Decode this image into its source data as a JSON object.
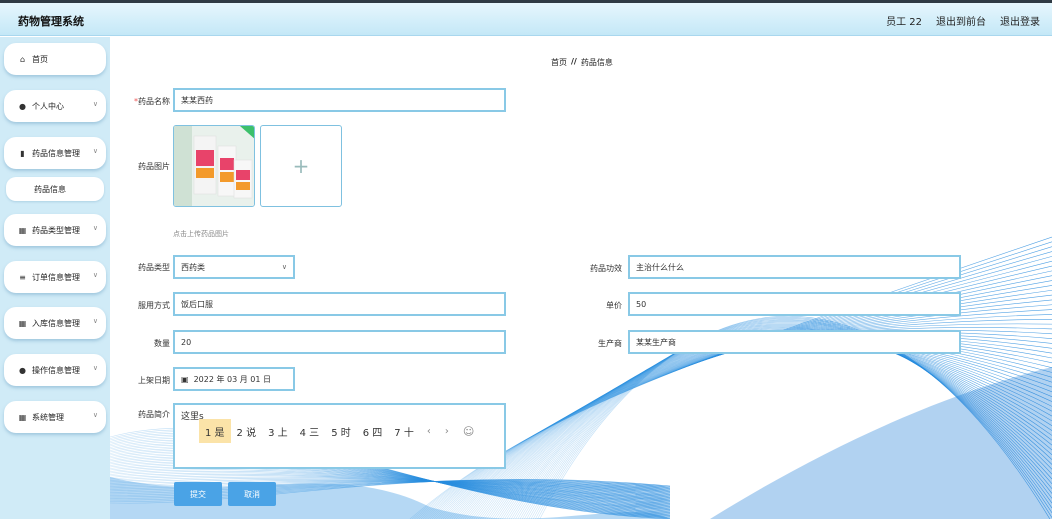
{
  "header": {
    "app_title": "药物管理系统",
    "user": "员工 22",
    "to_front": "退出到前台",
    "logout": "退出登录"
  },
  "sidebar": {
    "items": [
      {
        "label": "首页",
        "icon": "home-icon"
      },
      {
        "label": "个人中心",
        "icon": "user-icon"
      },
      {
        "label": "药品信息管理",
        "icon": "bars-icon"
      },
      {
        "label": "药品信息",
        "icon": ""
      },
      {
        "label": "药品类型管理",
        "icon": "grid-icon"
      },
      {
        "label": "订单信息管理",
        "icon": "list-icon"
      },
      {
        "label": "入库信息管理",
        "icon": "grid3-icon"
      },
      {
        "label": "操作信息管理",
        "icon": "user-icon"
      },
      {
        "label": "系统管理",
        "icon": "grid-icon"
      }
    ]
  },
  "breadcrumb": {
    "home": "首页",
    "sep": "//",
    "current": "药品信息"
  },
  "form": {
    "required_mark": "*",
    "name_label": "药品名称",
    "name_value": "某某西药",
    "image_label": "药品图片",
    "upload_hint": "点击上传药品图片",
    "upload_plus": "+",
    "type_label": "药品类型",
    "type_value": "西药类",
    "effect_label": "药品功效",
    "effect_value": "主治什么什么",
    "usage_label": "服用方式",
    "usage_value": "饭后口服",
    "price_label": "单价",
    "price_value": "50",
    "qty_label": "数量",
    "qty_value": "20",
    "maker_label": "生产商",
    "maker_value": "某某生产商",
    "date_label": "上架日期",
    "date_value": "2022 年 03 月 01 日",
    "intro_label": "药品简介",
    "intro_value": "这里s"
  },
  "ime": {
    "candidates": [
      "1 是",
      "2 说",
      "3 上",
      "4 三",
      "5 时",
      "6 四",
      "7 十"
    ],
    "prev": "‹",
    "next": "›",
    "emoji": "☺"
  },
  "buttons": {
    "submit": "提交",
    "cancel": "取消"
  }
}
